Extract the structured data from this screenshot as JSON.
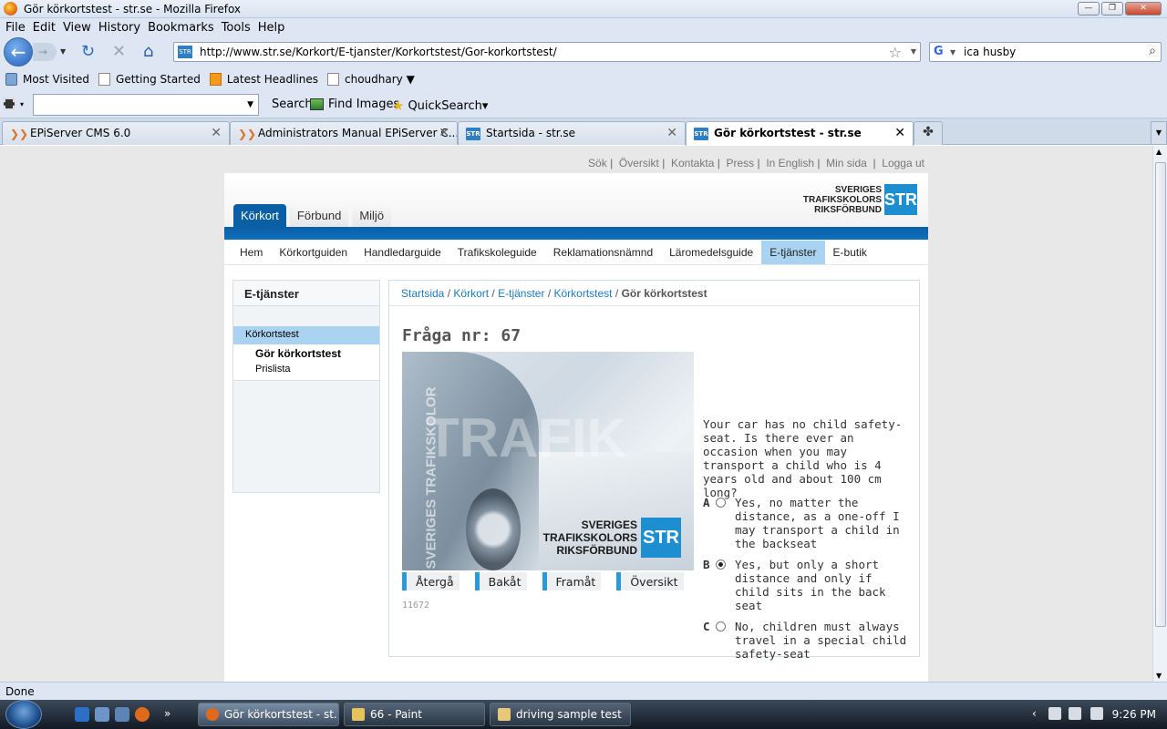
{
  "window": {
    "title": "Gör körkortstest - str.se - Mozilla Firefox"
  },
  "menu": [
    "File",
    "Edit",
    "View",
    "History",
    "Bookmarks",
    "Tools",
    "Help"
  ],
  "nav": {
    "url": "http://www.str.se/Korkort/E-tjanster/Korkortstest/Gor-korkortstest/",
    "search_query": "ica husby"
  },
  "bookmarks": [
    "Most Visited",
    "Getting Started",
    "Latest Headlines",
    "choudhary ▼"
  ],
  "toolbar": {
    "search_label": "Search",
    "find_images_label": "Find Images",
    "quicksearch_label": "QuickSearch▾"
  },
  "tabs": [
    {
      "label": "EPiServer CMS 6.0"
    },
    {
      "label": "Administrators Manual EPiServer C..."
    },
    {
      "label": "Startsida - str.se"
    },
    {
      "label": "Gör körkortstest - str.se"
    }
  ],
  "site": {
    "toplinks": [
      "Sök",
      "Översikt",
      "Kontakta",
      "Press",
      "In English",
      "Min sida",
      "Logga ut"
    ],
    "logo": {
      "line1": "SVERIGES",
      "line2": "TRAFIKSKOLORS",
      "line3": "RIKSFÖRBUND",
      "mark": "STR"
    },
    "main_tabs": [
      "Körkort",
      "Förbund",
      "Miljö"
    ],
    "subnav": [
      "Hem",
      "Körkortguiden",
      "Handledarguide",
      "Trafikskoleguide",
      "Reklamationsnämnd",
      "Läromedelsguide",
      "E-tjänster",
      "E-butik"
    ],
    "sidebar": {
      "heading": "E-tjänster",
      "selected": "Körkortstest",
      "items": [
        "Gör körkortstest",
        "Prislista"
      ]
    },
    "breadcrumb": [
      "Startsida",
      "Körkort",
      "E-tjänster",
      "Körkortstest",
      "Gör körkortstest"
    ],
    "question_title": "Fråga nr: 67",
    "image_text": {
      "vertical": "SVERIGES TRAFIKSKOLOR",
      "watermark": "TRAFIK"
    },
    "question": "Your car has no child safety-seat. Is there ever an occasion when you may transport a child who is 4 years old and about 100 cm long?",
    "answers": [
      {
        "letter": "A",
        "text": "Yes, no matter the distance, as a one-off I may transport a child in the backseat",
        "selected": false
      },
      {
        "letter": "B",
        "text": "Yes, but only a short distance and only if child sits in the back seat",
        "selected": true
      },
      {
        "letter": "C",
        "text": "No, children must always travel in a special child safety-seat",
        "selected": false
      }
    ],
    "buttons": [
      "Återgå",
      "Bakåt",
      "Framåt",
      "Översikt"
    ],
    "question_id": "11672"
  },
  "status": {
    "text": "Done"
  },
  "taskbar": {
    "items": [
      "Gör körkortstest - st...",
      "66 - Paint",
      "driving sample test"
    ],
    "clock": "9:26 PM"
  }
}
